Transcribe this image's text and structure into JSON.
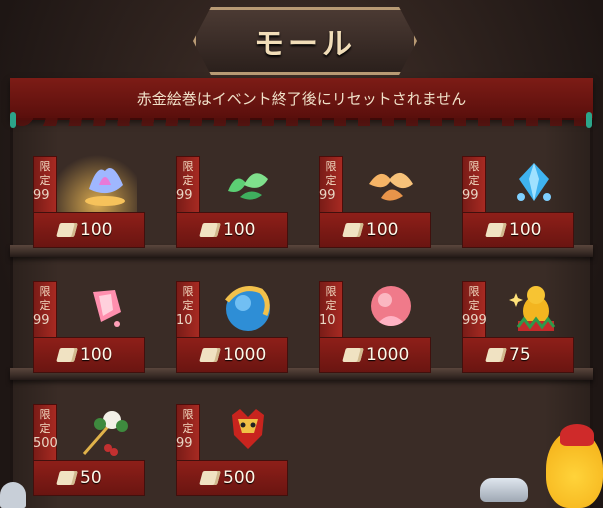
{
  "title": "モール",
  "banner": "赤金絵巻はイベント終了後にリセットされません",
  "colors": {
    "banner": "#7d1c16",
    "price_bar": "#8e1f19",
    "title": "#f1ddb8"
  },
  "limit_label": [
    "限",
    "定"
  ],
  "items": [
    {
      "icon": "crystal-orb-icon",
      "limit": "99",
      "price": "100"
    },
    {
      "icon": "green-leaves-icon",
      "limit": "99",
      "price": "100"
    },
    {
      "icon": "orange-crystal-icon",
      "limit": "99",
      "price": "100"
    },
    {
      "icon": "blue-gem-icon",
      "limit": "99",
      "price": "100"
    },
    {
      "icon": "pink-crystal-icon",
      "limit": "99",
      "price": "100"
    },
    {
      "icon": "dragon-orb-icon",
      "limit": "10",
      "price": "1000"
    },
    {
      "icon": "pink-lotus-orb-icon",
      "limit": "10",
      "price": "1000"
    },
    {
      "icon": "gold-chick-icon",
      "limit": "999",
      "price": "75"
    },
    {
      "icon": "flower-hairpin-icon",
      "limit": "500",
      "price": "50"
    },
    {
      "icon": "red-dragon-head-icon",
      "limit": "99",
      "price": "500"
    }
  ]
}
